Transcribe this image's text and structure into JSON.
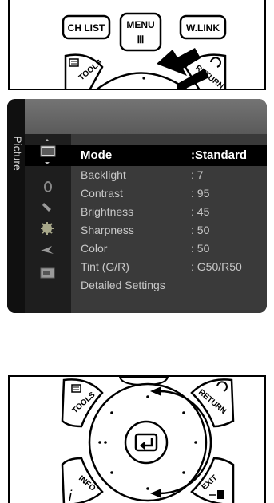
{
  "remote_top": {
    "ch_list": "CH LIST",
    "menu": "MENU",
    "menu_glyph": "Ⅲ",
    "wlink": "W.LINK",
    "tools": "TOOLS",
    "return": "RETURN"
  },
  "osd": {
    "tab_label": "Picture",
    "items": [
      {
        "label": "Mode",
        "value": ":Standard"
      },
      {
        "label": "Backlight",
        "value": ": 7"
      },
      {
        "label": "Contrast",
        "value": ": 95"
      },
      {
        "label": "Brightness",
        "value": ": 45"
      },
      {
        "label": "Sharpness",
        "value": ": 50"
      },
      {
        "label": "Color",
        "value": ": 50"
      },
      {
        "label": "Tint (G/R)",
        "value": ": G50/R50"
      },
      {
        "label": "Detailed Settings",
        "value": ""
      }
    ],
    "icons": [
      "picture-icon",
      "sound-icon",
      "channel-icon",
      "setup-icon",
      "input-icon",
      "application-icon"
    ]
  },
  "remote_bottom": {
    "tools": "TOOLS",
    "return": "RETURN",
    "info": "INFO",
    "info_glyph": "i",
    "exit": "EXIT"
  }
}
